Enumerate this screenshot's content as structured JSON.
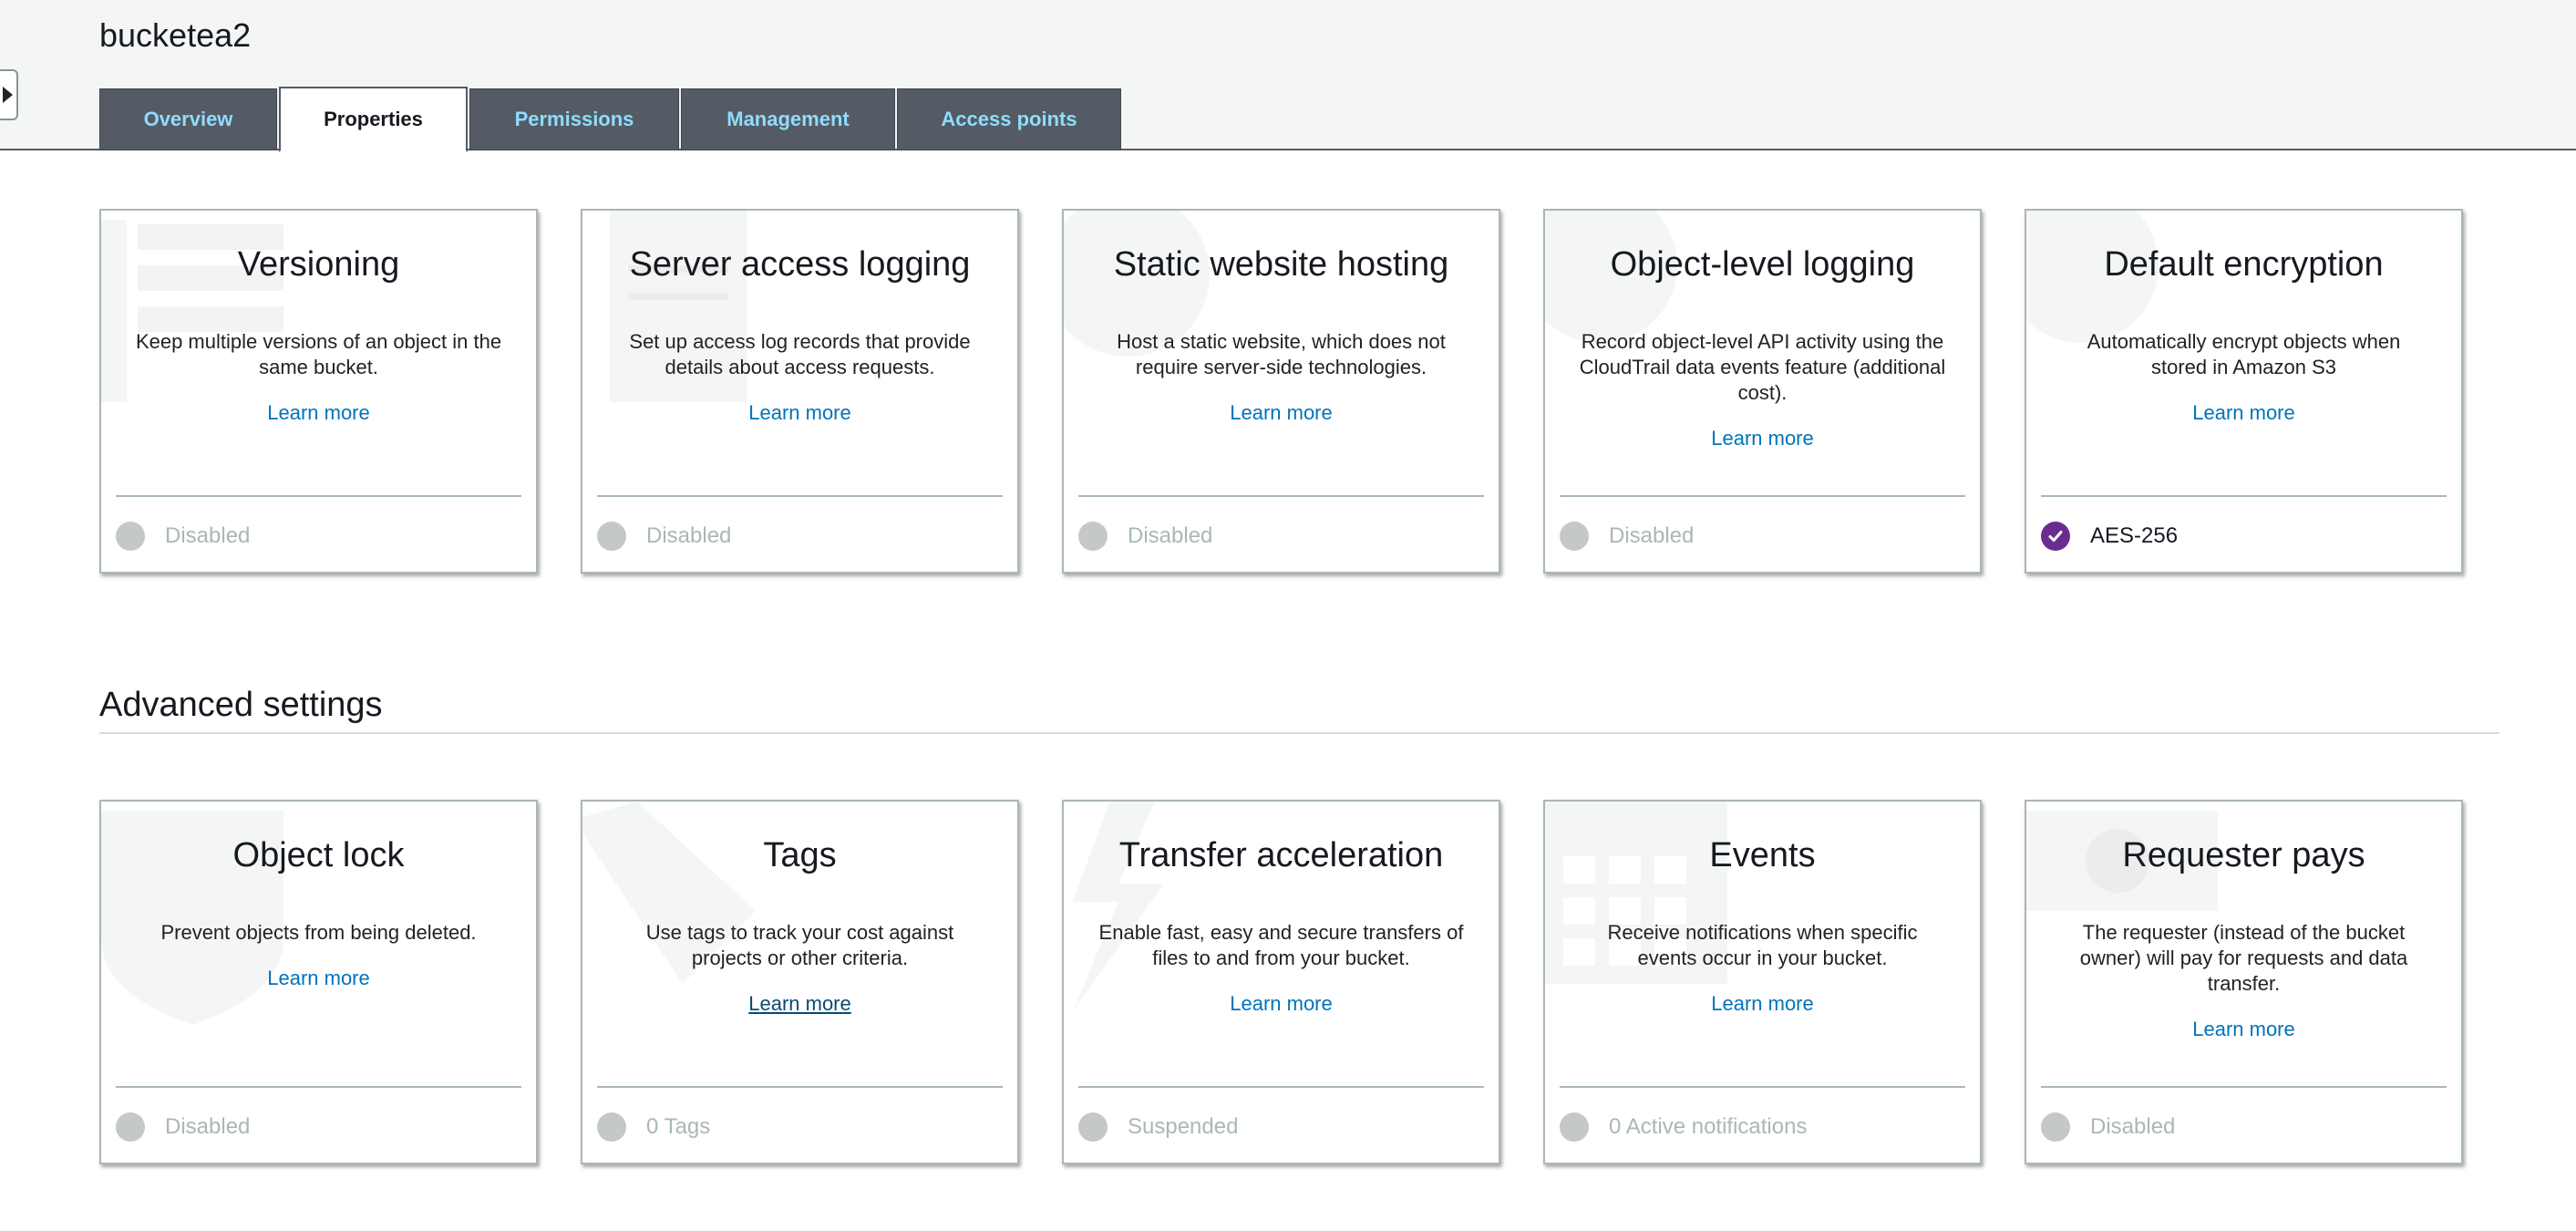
{
  "bucket": {
    "name": "bucketea2"
  },
  "tabs": [
    {
      "label": "Overview"
    },
    {
      "label": "Properties"
    },
    {
      "label": "Permissions"
    },
    {
      "label": "Management"
    },
    {
      "label": "Access points"
    }
  ],
  "properties": [
    {
      "title": "Versioning",
      "desc": "Keep multiple versions of an object in the same bucket.",
      "learn": "Learn more",
      "status": "Disabled"
    },
    {
      "title": "Server access logging",
      "desc": "Set up access log records that provide details about access requests.",
      "learn": "Learn more",
      "status": "Disabled"
    },
    {
      "title": "Static website hosting",
      "desc": "Host a static website, which does not require server-side technologies.",
      "learn": "Learn more",
      "status": "Disabled"
    },
    {
      "title": "Object-level logging",
      "desc": "Record object-level API activity using the CloudTrail data events feature (additional cost).",
      "learn": "Learn more",
      "status": "Disabled"
    },
    {
      "title": "Default encryption",
      "desc": "Automatically encrypt objects when stored in Amazon S3",
      "learn": "Learn more",
      "status": "AES-256"
    }
  ],
  "advanced": {
    "heading": "Advanced settings",
    "cards": [
      {
        "title": "Object lock",
        "desc": "Prevent objects from being deleted.",
        "learn": "Learn more",
        "status": "Disabled"
      },
      {
        "title": "Tags",
        "desc": "Use tags to track your cost against projects or other criteria.",
        "learn": "Learn more",
        "status": "0 Tags"
      },
      {
        "title": "Transfer acceleration",
        "desc": "Enable fast, easy and secure transfers of files to and from your bucket.",
        "learn": "Learn more",
        "status": "Suspended"
      },
      {
        "title": "Events",
        "desc": "Receive notifications when specific events occur in your bucket.",
        "learn": "Learn more",
        "status": "0 Active notifications"
      },
      {
        "title": "Requester pays",
        "desc": "The requester (instead of the bucket owner) will pay for requests and data transfer.",
        "learn": "Learn more",
        "status": "Disabled"
      }
    ]
  },
  "colors": {
    "tab_bg": "#545b64",
    "tab_text": "#8fdcff",
    "link": "#0073bb",
    "enabled_badge": "#6b2c91",
    "disabled_dot": "#c4c8c9"
  }
}
